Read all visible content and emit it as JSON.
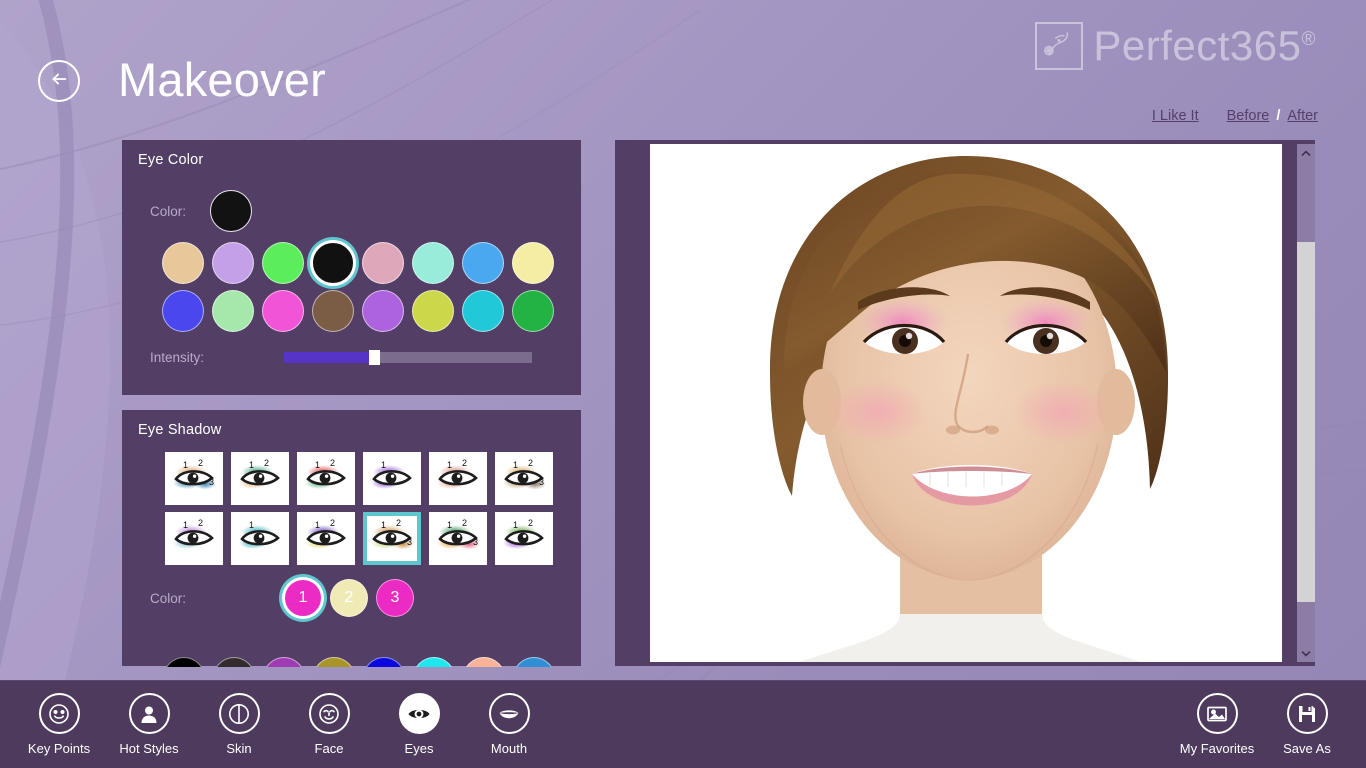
{
  "header": {
    "title": "Makeover",
    "back_icon": "back-arrow-icon",
    "brand_name": "Perfect365",
    "brand_registered": "®",
    "brand_icon": "face-logo-icon"
  },
  "topnav": {
    "like_label": "I Like It",
    "before_label": "Before",
    "separator": "/",
    "after_label": "After"
  },
  "eye_color": {
    "panel_title": "Eye Color",
    "color_label": "Color:",
    "intensity_label": "Intensity:",
    "current_color": "#121212",
    "intensity_percent": 35,
    "swatches_row1": [
      "#e8c89a",
      "#c4a0e8",
      "#5ced5c",
      "#111111",
      "#dfa8ba",
      "#99ecd9",
      "#4aa8f0",
      "#f6eda4"
    ],
    "swatches_row2": [
      "#4a47ef",
      "#a6e8ac",
      "#f254d8",
      "#7b5c45",
      "#ac63dd",
      "#ccd84a",
      "#21c8d8",
      "#22b342"
    ],
    "selected_index_row1": 3
  },
  "eye_shadow": {
    "panel_title": "Eye Shadow",
    "color_label": "Color:",
    "selected_style_row": 2,
    "selected_style_index": 3,
    "styles_row1": [
      {
        "name": "style-1",
        "c1": "#2f7fa8",
        "c2": "#d9a06a",
        "c3": "#2f7fa8",
        "labels": [
          "1",
          "2",
          "3"
        ]
      },
      {
        "name": "style-2",
        "c1": "#e6b87a",
        "c2": "#2f9e74",
        "c3": "",
        "labels": [
          "1",
          "2"
        ]
      },
      {
        "name": "style-3",
        "c1": "#3fae6a",
        "c2": "#e0393f",
        "c3": "",
        "labels": [
          "1",
          "2"
        ]
      },
      {
        "name": "style-4",
        "c1": "#8e4fd4",
        "c2": "",
        "c3": "",
        "labels": [
          "1"
        ]
      },
      {
        "name": "style-5",
        "c1": "#e39a7a",
        "c2": "#d98a7a",
        "c3": "",
        "labels": [
          "1",
          "2"
        ]
      },
      {
        "name": "style-6",
        "c1": "#c9a06a",
        "c2": "#d9a55e",
        "c3": "#8a7060",
        "labels": [
          "1",
          "2",
          "3"
        ]
      }
    ],
    "styles_row2": [
      {
        "name": "style-7",
        "c1": "#79b9c9",
        "c2": "#b87ad6",
        "c3": "",
        "labels": [
          "1",
          "2"
        ]
      },
      {
        "name": "style-8",
        "c1": "#2fa8bb",
        "c2": "",
        "c3": "",
        "labels": [
          "1"
        ]
      },
      {
        "name": "style-9",
        "c1": "#e3cf52",
        "c2": "#6a3fb5",
        "c3": "",
        "labels": [
          "1",
          "2"
        ]
      },
      {
        "name": "style-10",
        "c1": "#b9d46a",
        "c2": "#c98a3a",
        "c3": "#c98a3a",
        "labels": [
          "1",
          "2",
          "3"
        ]
      },
      {
        "name": "style-11",
        "c1": "#e39b2e",
        "c2": "#2f8f4a",
        "c3": "#e05a7a",
        "labels": [
          "1",
          "2",
          "3"
        ]
      },
      {
        "name": "style-12",
        "c1": "#9b4fd4",
        "c2": "#5fa83a",
        "c3": "",
        "labels": [
          "1",
          "2"
        ]
      }
    ],
    "num_swatches": [
      {
        "label": "1",
        "color": "#ec2bc4"
      },
      {
        "label": "2",
        "color": "#efeab6"
      },
      {
        "label": "3",
        "color": "#ec2bc4"
      }
    ],
    "selected_num_index": 0,
    "palette_row": [
      "#000000",
      "#332b2e",
      "#a03bb4",
      "#a89427",
      "#0a0ae0",
      "#1ee8ee",
      "#f6b396",
      "#2e8fd4"
    ]
  },
  "viewer": {
    "scroll_up_icon": "chevron-up-icon",
    "scroll_down_icon": "chevron-down-icon",
    "photo_alt": "model-face-after-makeover"
  },
  "toolbar": {
    "left_items": [
      {
        "label": "Key Points",
        "icon": "smiley-keypoints-icon",
        "active": false
      },
      {
        "label": "Hot Styles",
        "icon": "person-icon",
        "active": false
      },
      {
        "label": "Skin",
        "icon": "skin-circle-icon",
        "active": false
      },
      {
        "label": "Face",
        "icon": "face-icon",
        "active": false
      },
      {
        "label": "Eyes",
        "icon": "eye-icon",
        "active": true
      },
      {
        "label": "Mouth",
        "icon": "mouth-icon",
        "active": false
      }
    ],
    "right_items": [
      {
        "label": "My Favorites",
        "icon": "picture-icon",
        "active": false
      },
      {
        "label": "Save As",
        "icon": "floppy-disk-icon",
        "active": false
      }
    ]
  },
  "colors": {
    "panel_bg": "#533f66",
    "toolbar_bg": "#4d3a5c",
    "accent_select": "#5fc6cf",
    "slider_fill": "#5634c8",
    "page_bg": "#a496c2"
  }
}
